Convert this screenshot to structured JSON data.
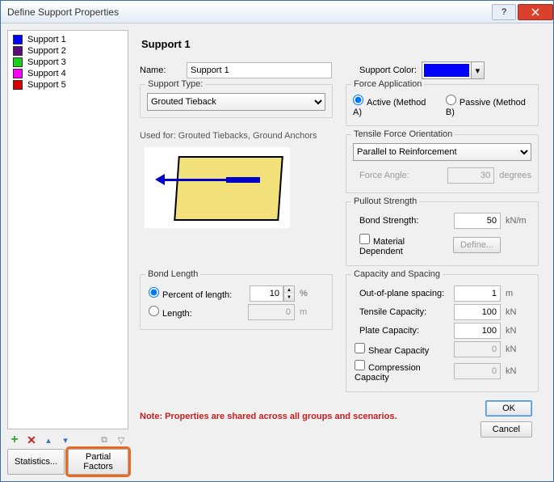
{
  "title": "Define Support Properties",
  "supports": [
    {
      "label": "Support 1",
      "color": "#0000fe"
    },
    {
      "label": "Support 2",
      "color": "#5b0a78"
    },
    {
      "label": "Support 3",
      "color": "#18d018"
    },
    {
      "label": "Support 4",
      "color": "#ff00ff"
    },
    {
      "label": "Support 5",
      "color": "#d80000"
    }
  ],
  "header": "Support 1",
  "name_label": "Name:",
  "name_value": "Support 1",
  "support_color_label": "Support Color:",
  "support_color": "#0000fe",
  "support_type": {
    "group": "Support Type:",
    "value": "Grouted Tieback",
    "used_for": "Used for: Grouted Tiebacks, Ground Anchors"
  },
  "force_app": {
    "group": "Force Application",
    "active": "Active (Method A)",
    "passive": "Passive (Method B)"
  },
  "tfo": {
    "group": "Tensile Force Orientation",
    "value": "Parallel to Reinforcement",
    "angle_label": "Force Angle:",
    "angle_value": "30",
    "angle_unit": "degrees"
  },
  "pullout": {
    "group": "Pullout Strength",
    "bond_label": "Bond Strength:",
    "bond_value": "50",
    "bond_unit": "kN/m",
    "mat_dep": "Material Dependent",
    "define": "Define..."
  },
  "bond_length": {
    "group": "Bond Length",
    "percent_label": "Percent of length:",
    "percent_value": "10",
    "percent_unit": "%",
    "length_label": "Length:",
    "length_value": "0",
    "length_unit": "m"
  },
  "capacity": {
    "group": "Capacity and Spacing",
    "spacing_label": "Out-of-plane spacing:",
    "spacing_value": "1",
    "spacing_unit": "m",
    "tensile_label": "Tensile Capacity:",
    "tensile_value": "100",
    "plate_label": "Plate Capacity:",
    "plate_value": "100",
    "shear_label": "Shear Capacity",
    "shear_value": "0",
    "comp_label": "Compression Capacity",
    "comp_value": "0",
    "kn": "kN"
  },
  "note": "Note: Properties are shared across all groups and scenarios.",
  "buttons": {
    "stats": "Statistics...",
    "partial": "Partial Factors",
    "ok": "OK",
    "cancel": "Cancel"
  }
}
